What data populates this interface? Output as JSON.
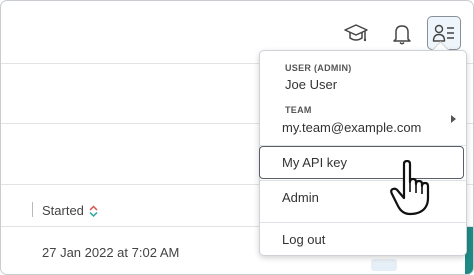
{
  "header": {
    "icons": {
      "learn": "graduation-cap-icon",
      "notifications": "bell-icon",
      "user": "user-card-icon"
    }
  },
  "table": {
    "column_started": "Started",
    "row_started_value": "27 Jan 2022 at 7:02 AM"
  },
  "user_menu": {
    "user_label": "USER (ADMIN)",
    "user_name": "Joe User",
    "team_label": "TEAM",
    "team_email": "my.team@example.com",
    "items": {
      "api_key": "My API key",
      "admin": "Admin",
      "logout": "Log out"
    }
  },
  "colors": {
    "accent_teal": "#1f8a84",
    "user_button_bg": "#eef5fb",
    "sort_up": "#d9534f",
    "sort_down": "#2fa39b"
  }
}
